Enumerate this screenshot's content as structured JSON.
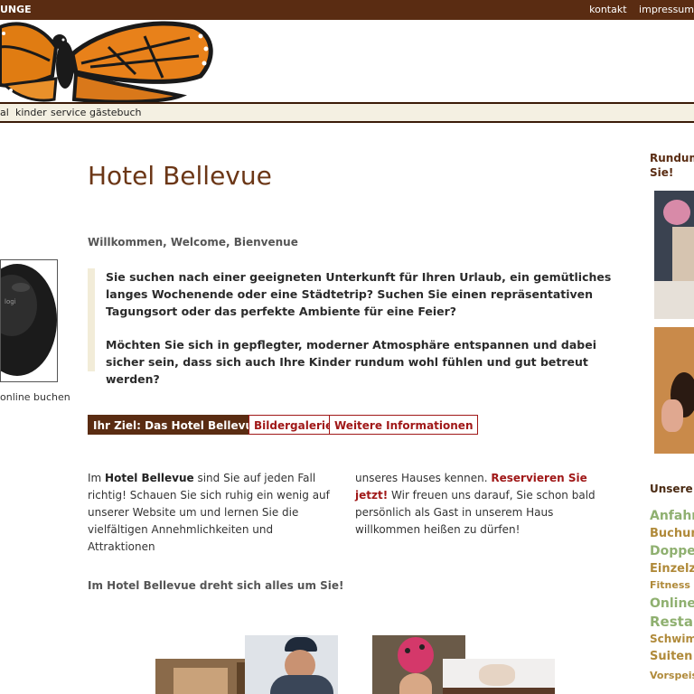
{
  "topbar": {
    "brand": "UNGE",
    "links": [
      "kontakt",
      "impressum"
    ]
  },
  "nav": {
    "items": [
      "al",
      "kinder",
      "service",
      "gästebuch"
    ]
  },
  "left": {
    "caption": "online buchen"
  },
  "main": {
    "title": "Hotel Bellevue",
    "welcome": "Willkommen, Welcome, Bienvenue",
    "quote_p1": "Sie suchen nach einer geeigneten Unterkunft für Ihren Urlaub, ein gemütliches langes Wochenende oder eine Städtetrip? Suchen Sie einen repräsentativen Tagungsort oder das perfekte Ambiente für eine Feier?",
    "quote_p2": "Möchten Sie sich in gepflegter, moderner Atmosphäre entspannen und dabei sicher sein, dass sich auch Ihre Kinder rundum wohl fühlen und gut betreut werden?",
    "tabs": [
      "Ihr Ziel: Das Hotel Bellevue",
      "Bildergalerie",
      "Weitere Informationen"
    ],
    "col1": {
      "pre": "Im ",
      "bold": "Hotel Bellevue",
      "post": " sind Sie auf jeden Fall richtig! Schauen Sie sich ruhig ein wenig auf unserer Website um und lernen Sie die vielfältigen Annehmlichkeiten und Attraktionen"
    },
    "col2": {
      "pre": "unseres Hauses kennen. ",
      "link": "Reservieren Sie jetzt!",
      "post": " Wir freuen uns darauf, Sie schon bald persönlich als Gast in unserem Haus willkommen heißen zu dürfen!"
    },
    "slogan": "Im Hotel Bellevue dreht sich alles um Sie!"
  },
  "sidebar": {
    "heading1": "Rundum",
    "heading1b": "Sie!",
    "heading2": "Unsere",
    "tags": [
      {
        "label": "Anfahrt",
        "color": "#8fb070",
        "size": 14
      },
      {
        "label": "Buchun",
        "color": "#b08a3a",
        "size": 13
      },
      {
        "label": "Doppel",
        "color": "#8fb070",
        "size": 14
      },
      {
        "label": "Einzelzi",
        "color": "#b08a3a",
        "size": 13
      },
      {
        "label": "Fitness c",
        "color": "#b08a3a",
        "size": 11
      },
      {
        "label": "Online",
        "color": "#8fb070",
        "size": 14
      },
      {
        "label": "Restau",
        "color": "#8fb070",
        "size": 15
      },
      {
        "label": "Schwim",
        "color": "#b08a3a",
        "size": 12
      },
      {
        "label": "Suiten",
        "color": "#b08a3a",
        "size": 13
      },
      {
        "label": "Vorspeis",
        "color": "#b08a3a",
        "size": 11
      }
    ]
  },
  "colors": {
    "brand_brown": "#5a2c12",
    "accent_red": "#a01818",
    "quote_bar": "#f2ecd8"
  }
}
